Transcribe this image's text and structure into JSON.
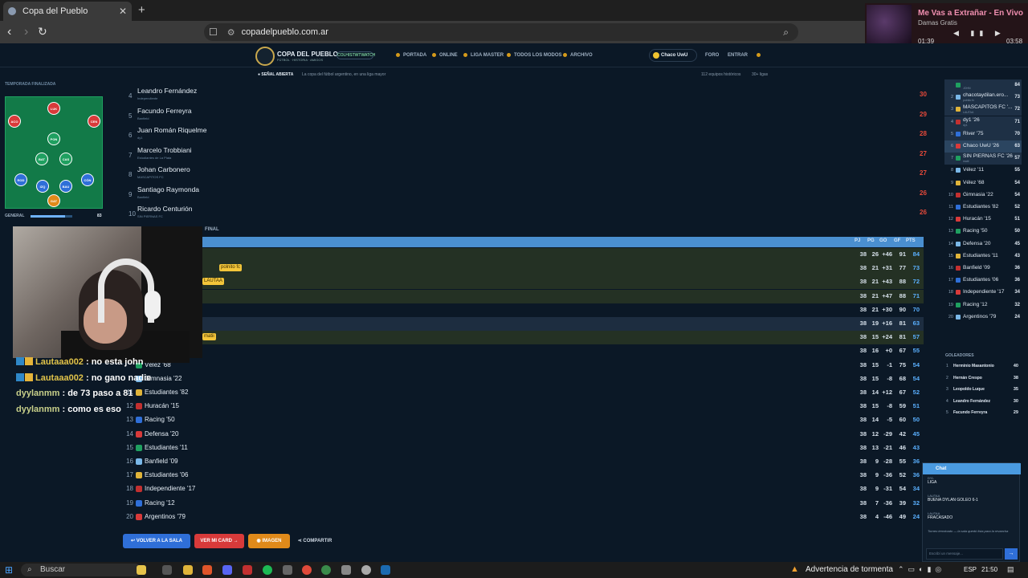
{
  "browser": {
    "tab_title": "Copa del Pueblo",
    "url": "copadelpueblo.com.ar"
  },
  "media": {
    "title": "Me Vas a Extrañar - En Vivo",
    "artist": "Damas Gratis",
    "elapsed": "01:39",
    "duration": "03:58",
    "progress_fraction": 0.42
  },
  "site": {
    "brand": "COPA DEL PUEBLO",
    "brand_sub": "FÚTBOL · HISTORIA · AMIGOS",
    "badge": "COLHISTWTWATCH",
    "menu": [
      "PORTADA",
      "ONLINE",
      "LIGA MASTER",
      "TODOS LOS MODOS",
      "ARCHIVO"
    ],
    "user": "Chaco UwU",
    "foro": "FORO",
    "entrar": "ENTRAR",
    "signal": "SEÑAL ABIERTA",
    "signal_sub": "La copa del fútbol argentino, en una liga mayor",
    "stat1": "112 equipos históricos",
    "stat2": "30+ ligas"
  },
  "left_panel": {
    "season_label": "TEMPORADA FINALIZADA",
    "players": [
      "LUK",
      "ACO",
      "CEN",
      "PON",
      "BAT",
      "CAS",
      "ROD",
      "IZQ",
      "BAU",
      "CÓN",
      "GAT"
    ],
    "general_label": "GENERAL",
    "general_value": "83",
    "general_fraction": 0.83,
    "section_label": "FINAL"
  },
  "overlay_chat": [
    {
      "user": "Lautaaa002",
      "text": ": no esta john"
    },
    {
      "user": "Lautaaa002",
      "text": ": no gano nadie"
    },
    {
      "user": "dyylanmm",
      "text": ": de 73 paso a 81"
    },
    {
      "user": "dyylanmm",
      "text": ": como es eso"
    }
  ],
  "top_scorers": [
    {
      "pos": "4",
      "name": "Leandro Fernández",
      "team": "Independiente",
      "goals": "30"
    },
    {
      "pos": "5",
      "name": "Facundo Ferreyra",
      "team": "Banfield",
      "goals": "29"
    },
    {
      "pos": "6",
      "name": "Juan Román Riquelme",
      "team": "dy1",
      "goals": "28"
    },
    {
      "pos": "7",
      "name": "Marcelo Trobbiani",
      "team": "Estudiantes de La Plata",
      "goals": "27"
    },
    {
      "pos": "8",
      "name": "Johan Carbonero",
      "team": "MASCAPITOS FC",
      "goals": "27"
    },
    {
      "pos": "9",
      "name": "Santiago Raymonda",
      "team": "Banfield",
      "goals": "26"
    },
    {
      "pos": "10",
      "name": "Ricardo Centurión",
      "team": "SIN PIERNAS FC",
      "goals": "26"
    }
  ],
  "table_headers": [
    "PJ",
    "PG",
    "GO",
    "GF",
    "PTS"
  ],
  "standings": [
    {
      "pos": "",
      "name": "",
      "tag": "",
      "pj": "38",
      "pg": "26",
      "go": "+46",
      "gf": "91",
      "pts": "84",
      "band": true
    },
    {
      "pos": "",
      "name": "e '26",
      "tag": "polnito fc",
      "pj": "38",
      "pg": "21",
      "go": "+31",
      "gf": "77",
      "pts": "73",
      "band": true
    },
    {
      "pos": "",
      "name": "",
      "tag": "LAUTAA",
      "pj": "38",
      "pg": "21",
      "go": "+43",
      "gf": "88",
      "pts": "72",
      "band": true
    },
    {
      "pos": "",
      "name": "",
      "tag": "",
      "pj": "38",
      "pg": "21",
      "go": "+47",
      "gf": "88",
      "pts": "71",
      "band": true
    },
    {
      "pos": "",
      "name": "",
      "tag": "",
      "pj": "38",
      "pg": "21",
      "go": "+30",
      "gf": "90",
      "pts": "70",
      "band": false
    },
    {
      "pos": "",
      "name": "",
      "tag": "",
      "pj": "38",
      "pg": "19",
      "go": "+16",
      "gf": "81",
      "pts": "63",
      "sel": true
    },
    {
      "pos": "",
      "name": "",
      "tag": "matii",
      "pj": "38",
      "pg": "15",
      "go": "+24",
      "gf": "81",
      "pts": "57",
      "band": true
    },
    {
      "pos": "",
      "name": "",
      "tag": "",
      "pj": "38",
      "pg": "16",
      "go": "+0",
      "gf": "67",
      "pts": "55"
    },
    {
      "pos": "",
      "name": "Vélez '68",
      "tag": "",
      "pj": "38",
      "pg": "15",
      "go": "-1",
      "gf": "75",
      "pts": "54"
    },
    {
      "pos": "",
      "name": "Gimnasia '22",
      "tag": "",
      "pj": "38",
      "pg": "15",
      "go": "-8",
      "gf": "68",
      "pts": "54"
    },
    {
      "pos": "11",
      "name": "Estudiantes '82",
      "tag": "",
      "pj": "38",
      "pg": "14",
      "go": "+12",
      "gf": "67",
      "pts": "52"
    },
    {
      "pos": "12",
      "name": "Huracán '15",
      "tag": "",
      "pj": "38",
      "pg": "15",
      "go": "-8",
      "gf": "59",
      "pts": "51"
    },
    {
      "pos": "13",
      "name": "Racing '50",
      "tag": "",
      "pj": "38",
      "pg": "14",
      "go": "-5",
      "gf": "60",
      "pts": "50"
    },
    {
      "pos": "14",
      "name": "Defensa '20",
      "tag": "",
      "pj": "38",
      "pg": "12",
      "go": "-29",
      "gf": "42",
      "pts": "45"
    },
    {
      "pos": "15",
      "name": "Estudiantes '11",
      "tag": "",
      "pj": "38",
      "pg": "13",
      "go": "-21",
      "gf": "46",
      "pts": "43"
    },
    {
      "pos": "16",
      "name": "Banfield '09",
      "tag": "",
      "pj": "38",
      "pg": "9",
      "go": "-28",
      "gf": "55",
      "pts": "36"
    },
    {
      "pos": "17",
      "name": "Estudiantes '06",
      "tag": "",
      "pj": "38",
      "pg": "9",
      "go": "-36",
      "gf": "52",
      "pts": "36"
    },
    {
      "pos": "18",
      "name": "Independiente '17",
      "tag": "",
      "pj": "38",
      "pg": "9",
      "go": "-31",
      "gf": "54",
      "pts": "34"
    },
    {
      "pos": "19",
      "name": "Racing '12",
      "tag": "",
      "pj": "38",
      "pg": "7",
      "go": "-36",
      "gf": "39",
      "pts": "32"
    },
    {
      "pos": "20",
      "name": "Argentinos '79",
      "tag": "",
      "pj": "38",
      "pg": "4",
      "go": "-46",
      "gf": "49",
      "pts": "24"
    }
  ],
  "buttons": {
    "back": "↩ VOLVER A LA SALA",
    "card": "VER MI CARD →",
    "image": "IMAGEN",
    "share": "COMPARTIR"
  },
  "right_standings": [
    {
      "pos": "",
      "name": "",
      "sub": "JOHN",
      "v": "84"
    },
    {
      "pos": "2",
      "name": "chacotaydilan.ero...",
      "sub": "polnito fc",
      "v": "73"
    },
    {
      "pos": "3",
      "name": "MASCAPITOS FC '...",
      "sub": "LAUTAA",
      "v": "72"
    },
    {
      "pos": "4",
      "name": "dy1 '26",
      "sub": "dy1",
      "v": "71"
    },
    {
      "pos": "5",
      "name": "River '75",
      "sub": "",
      "v": "70"
    },
    {
      "pos": "6",
      "name": "Chaco UwU '26",
      "sub": "",
      "v": "63"
    },
    {
      "pos": "7",
      "name": "SIN PIERNAS FC '26",
      "sub": "matii",
      "v": "57"
    },
    {
      "pos": "8",
      "name": "Vélez '11",
      "sub": "",
      "v": "55"
    },
    {
      "pos": "9",
      "name": "Vélez '68",
      "sub": "",
      "v": "54"
    },
    {
      "pos": "10",
      "name": "Gimnasia '22",
      "sub": "",
      "v": "54"
    },
    {
      "pos": "11",
      "name": "Estudiantes '82",
      "sub": "",
      "v": "52"
    },
    {
      "pos": "12",
      "name": "Huracán '15",
      "sub": "",
      "v": "51"
    },
    {
      "pos": "13",
      "name": "Racing '50",
      "sub": "",
      "v": "50"
    },
    {
      "pos": "14",
      "name": "Defensa '20",
      "sub": "",
      "v": "45"
    },
    {
      "pos": "15",
      "name": "Estudiantes '11",
      "sub": "",
      "v": "43"
    },
    {
      "pos": "16",
      "name": "Banfield '09",
      "sub": "",
      "v": "36"
    },
    {
      "pos": "17",
      "name": "Estudiantes '06",
      "sub": "",
      "v": "36"
    },
    {
      "pos": "18",
      "name": "Independiente '17",
      "sub": "",
      "v": "34"
    },
    {
      "pos": "19",
      "name": "Racing '12",
      "sub": "",
      "v": "32"
    },
    {
      "pos": "20",
      "name": "Argentinos '79",
      "sub": "",
      "v": "24"
    }
  ],
  "goleadores_title": "GOLEADORES",
  "goleadores": [
    {
      "pos": "1",
      "name": "Hermínio Masantonio",
      "v": "40"
    },
    {
      "pos": "2",
      "name": "Hernán Crespo",
      "v": "38"
    },
    {
      "pos": "3",
      "name": "Leopoldo Luque",
      "v": "35"
    },
    {
      "pos": "4",
      "name": "Leandro Fernández",
      "v": "30"
    },
    {
      "pos": "5",
      "name": "Facundo Ferreyra",
      "v": "29"
    }
  ],
  "chat": {
    "title": "Chat",
    "messages": [
      {
        "user": "DYL",
        "text": "LIGA"
      },
      {
        "user": "LAUTAA",
        "text": "BUENA DYLAN GOLEO 6-1"
      },
      {
        "user": "LAUTAA",
        "text": "FRACASADO"
      }
    ],
    "system": "Torneo terminado — la sala quedó lista para la revancha",
    "placeholder": "Escribí un mensaje..."
  },
  "taskbar": {
    "search": "Buscar",
    "weather": "Advertencia de tormenta",
    "lang": "ESP",
    "time": "21:50"
  }
}
